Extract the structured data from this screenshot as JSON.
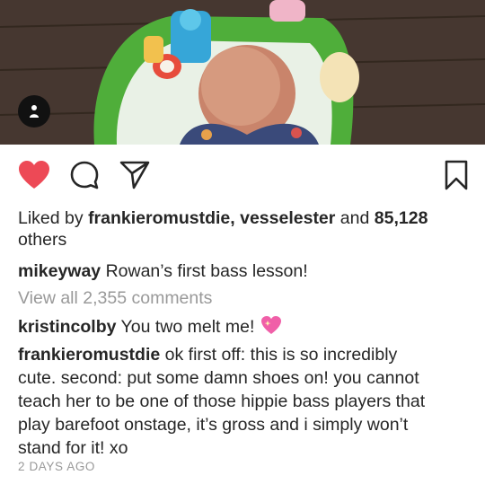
{
  "post": {
    "photo_alt": "baby in activity center",
    "likes": {
      "prefix": "Liked by",
      "users": "frankieromustdie, vesselester",
      "mid": "and",
      "count": "85,128",
      "suffix": "others"
    },
    "caption": {
      "user": "mikeyway",
      "text": "Rowan’s first bass lesson!"
    },
    "view_all": "View all 2,355 comments",
    "comments": [
      {
        "user": "kristincolby",
        "text": "You two melt me!"
      },
      {
        "user": "frankieromustdie",
        "line1": "ok first off: this is so incredibly",
        "line2": "cute. second: put some damn shoes on! you cannot",
        "line3": "teach her to be one of those hippie bass players that",
        "line4": "play barefoot onstage, it’s gross and i simply won’t",
        "line5": "stand for it! xo"
      }
    ],
    "timestamp": "2 DAYS AGO"
  },
  "icons": {
    "like": "heart-filled-icon",
    "comment": "comment-bubble-icon",
    "share": "paper-plane-icon",
    "save": "bookmark-icon",
    "tag": "user-tag-icon",
    "emoji": "sparkling-heart-emoji"
  },
  "colors": {
    "like": "#ed4956",
    "muted": "#999999",
    "text": "#262626"
  }
}
